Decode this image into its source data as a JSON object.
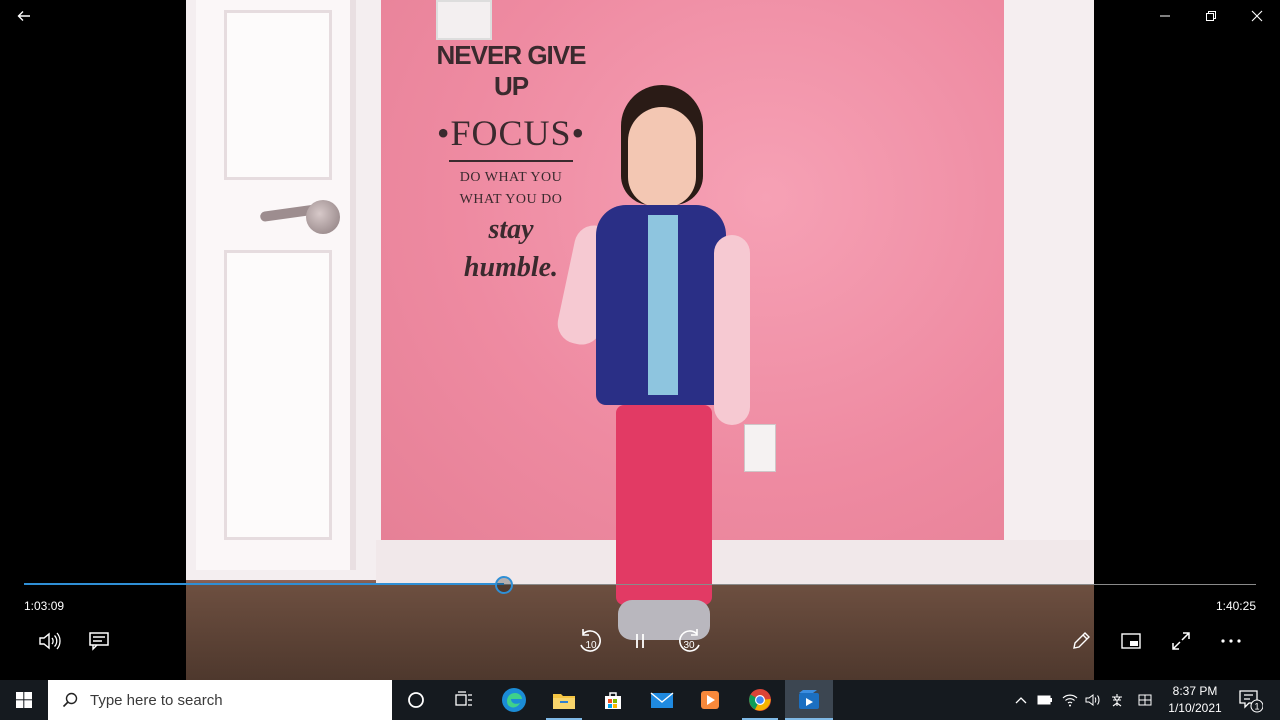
{
  "player": {
    "current_time": "1:03:09",
    "total_time": "1:40:25",
    "progress_fraction": 0.3897,
    "skip_back_seconds": "10",
    "skip_forward_seconds": "30",
    "state": "playing",
    "accent_color": "#2f8fd6"
  },
  "video_frame": {
    "wall_text": {
      "line1": "NEVER GIVE UP",
      "line2": "•FOCUS•",
      "line3": "DO WHAT YOU",
      "line4": "WHAT YOU DO",
      "line5": "stay",
      "line6": "humble."
    }
  },
  "controls": {
    "left": [
      "volume-icon",
      "subtitles-icon"
    ],
    "center": [
      "skip-back-10-icon",
      "pause-icon",
      "skip-forward-30-icon"
    ],
    "right": [
      "pencil-icon",
      "mini-view-icon",
      "fullscreen-icon",
      "more-icon"
    ]
  },
  "taskbar": {
    "search_placeholder": "Type here to search",
    "apps": [
      "cortana-icon",
      "task-view-icon",
      "edge-icon",
      "file-explorer-icon",
      "store-icon",
      "mail-icon",
      "media-player-icon",
      "chrome-icon",
      "movies-tv-icon"
    ],
    "clock_time": "8:37 PM",
    "clock_date": "1/10/2021",
    "notification_count": "1",
    "background_color": "#151a1f"
  }
}
